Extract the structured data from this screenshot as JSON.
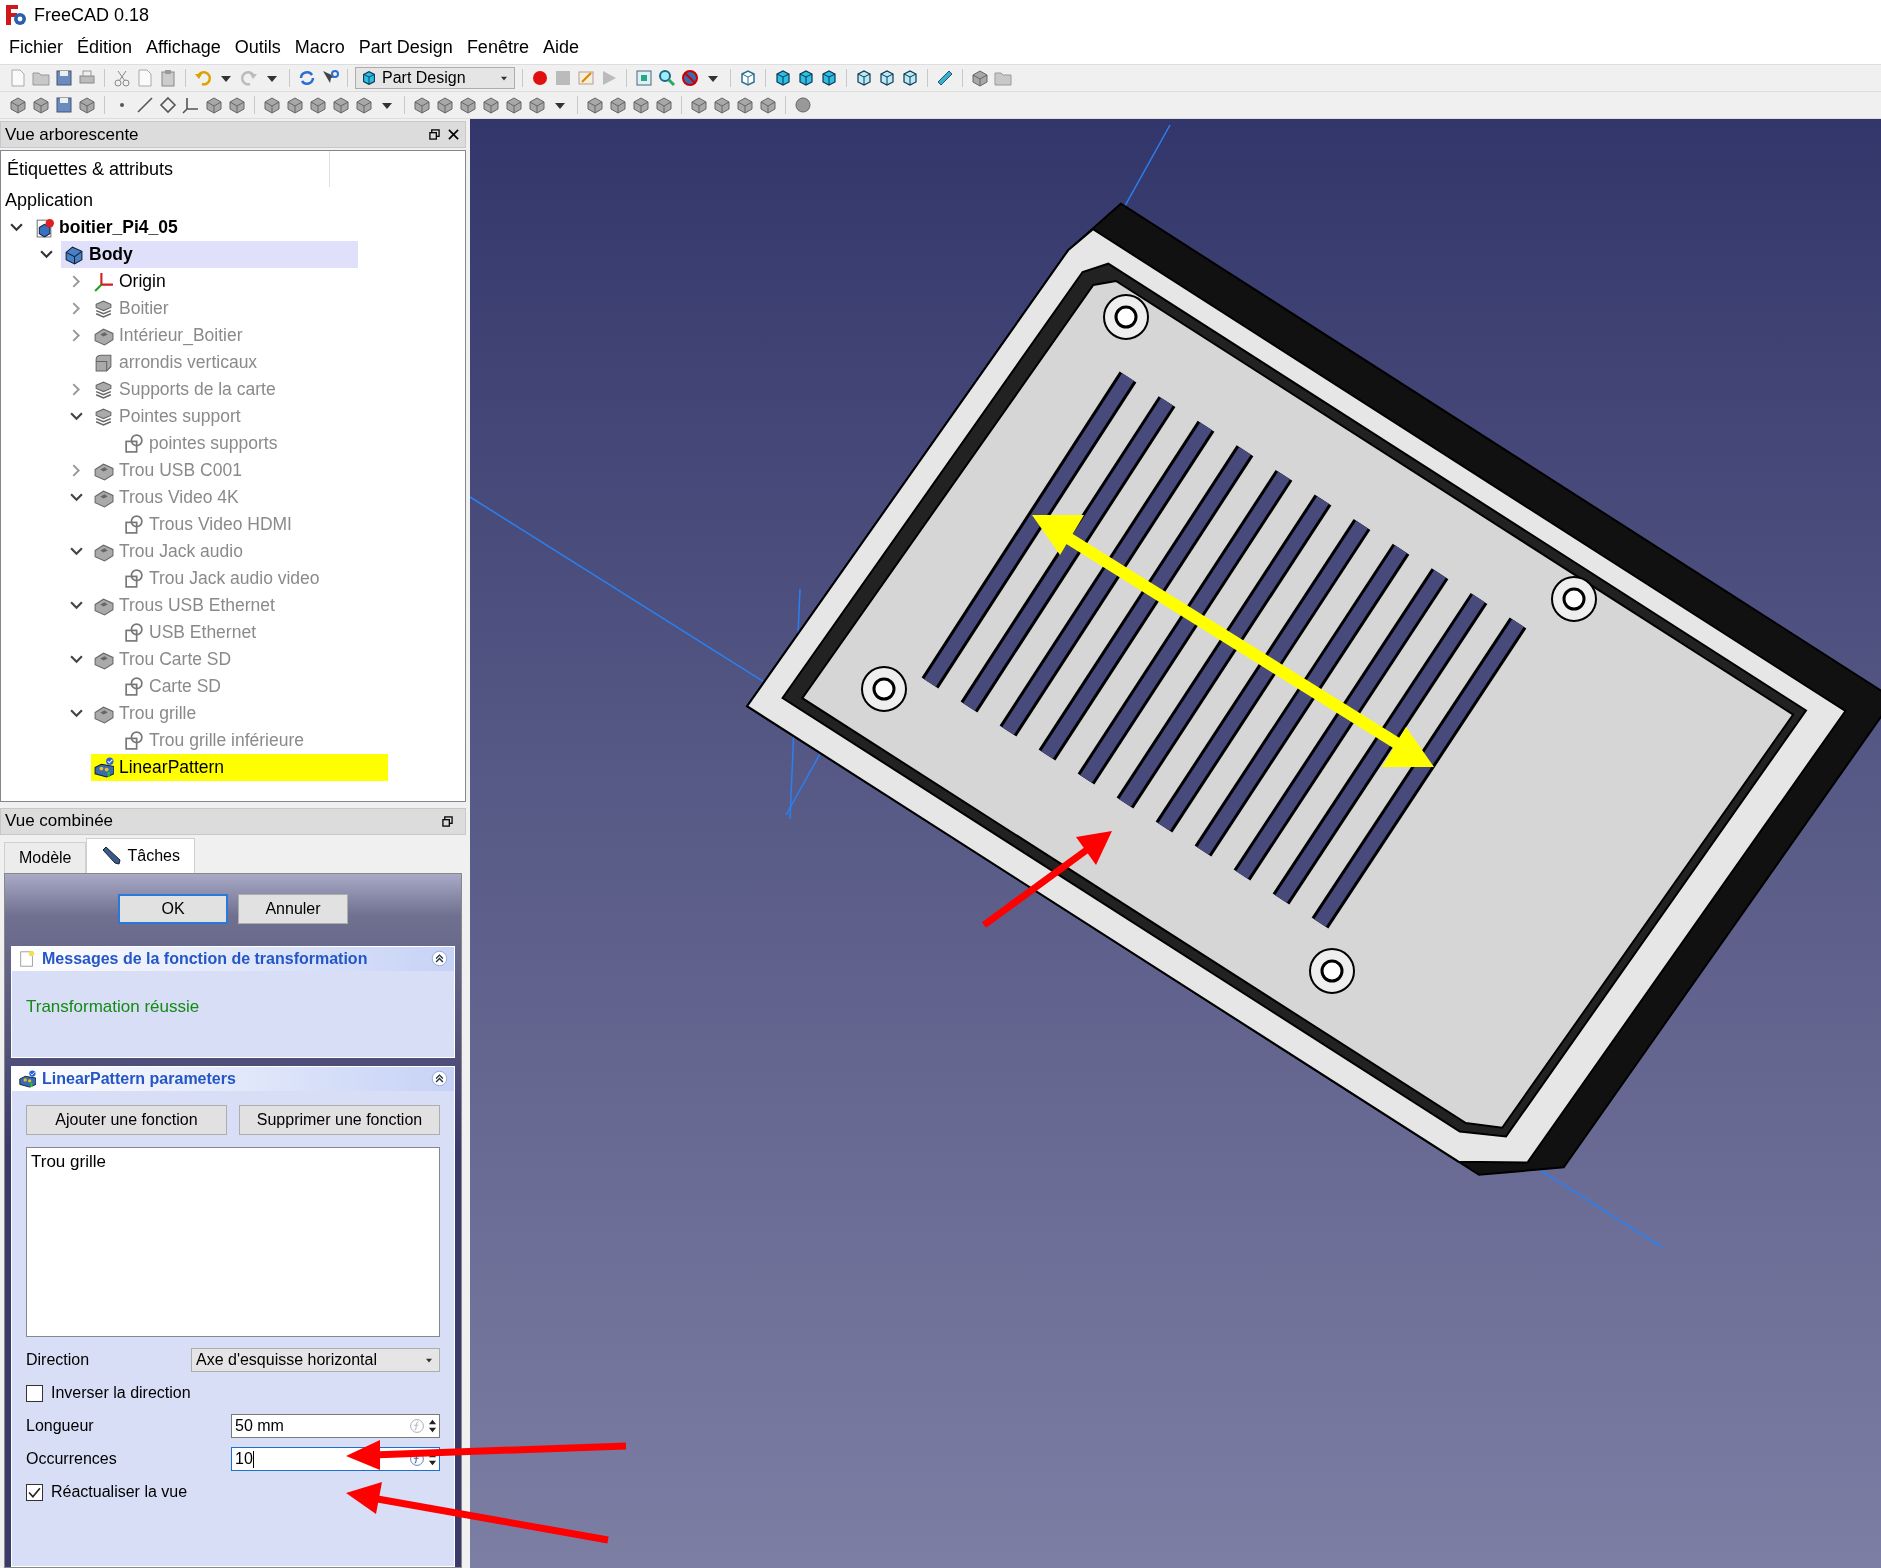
{
  "window": {
    "title": "FreeCAD 0.18"
  },
  "menu": [
    "Fichier",
    "Édition",
    "Affichage",
    "Outils",
    "Macro",
    "Part Design",
    "Fenêtre",
    "Aide"
  ],
  "toolbar": {
    "workbench": "Part Design"
  },
  "tree_panel": {
    "title": "Vue arborescente",
    "column": "Étiquettes & attributs",
    "root": "Application",
    "items": [
      {
        "label": "boitier_Pi4_05",
        "kind": "document",
        "visible": true,
        "active": false,
        "selected": false,
        "expanded": true,
        "children": [
          {
            "label": "Body",
            "kind": "body",
            "visible": true,
            "active": true,
            "selected": false,
            "expanded": true,
            "children": [
              {
                "label": "Origin",
                "kind": "origin",
                "visible": true,
                "active": false,
                "selected": false,
                "expanded": false
              },
              {
                "label": "Boitier",
                "kind": "stack",
                "visible": false,
                "active": false,
                "selected": false,
                "expanded": false
              },
              {
                "label": "Intérieur_Boitier",
                "kind": "pocket",
                "visible": false,
                "active": false,
                "selected": false,
                "expanded": false
              },
              {
                "label": "arrondis verticaux",
                "kind": "fillet",
                "visible": false,
                "active": false,
                "selected": false
              },
              {
                "label": "Supports de la carte",
                "kind": "stack",
                "visible": false,
                "active": false,
                "selected": false,
                "expanded": false
              },
              {
                "label": "Pointes support",
                "kind": "stack",
                "visible": false,
                "active": false,
                "selected": false,
                "expanded": true,
                "children": [
                  {
                    "label": "pointes supports",
                    "kind": "sketch",
                    "visible": false,
                    "active": false,
                    "selected": false
                  }
                ]
              },
              {
                "label": "Trou USB C001",
                "kind": "pocket",
                "visible": false,
                "active": false,
                "selected": false,
                "expanded": false
              },
              {
                "label": "Trous Video 4K",
                "kind": "pocket",
                "visible": false,
                "active": false,
                "selected": false,
                "expanded": true,
                "children": [
                  {
                    "label": "Trous Video HDMI",
                    "kind": "sketch",
                    "visible": false,
                    "active": false,
                    "selected": false
                  }
                ]
              },
              {
                "label": "Trou Jack audio",
                "kind": "pocket",
                "visible": false,
                "active": false,
                "selected": false,
                "expanded": true,
                "children": [
                  {
                    "label": "Trou Jack audio video",
                    "kind": "sketch",
                    "visible": false,
                    "active": false,
                    "selected": false
                  }
                ]
              },
              {
                "label": "Trous USB Ethernet",
                "kind": "pocket",
                "visible": false,
                "active": false,
                "selected": false,
                "expanded": true,
                "children": [
                  {
                    "label": "USB Ethernet",
                    "kind": "sketch",
                    "visible": false,
                    "active": false,
                    "selected": false
                  }
                ]
              },
              {
                "label": "Trou Carte SD",
                "kind": "pocket",
                "visible": false,
                "active": false,
                "selected": false,
                "expanded": true,
                "children": [
                  {
                    "label": "Carte SD",
                    "kind": "sketch",
                    "visible": false,
                    "active": false,
                    "selected": false
                  }
                ]
              },
              {
                "label": "Trou grille",
                "kind": "pocket",
                "visible": false,
                "active": false,
                "selected": false,
                "expanded": true,
                "children": [
                  {
                    "label": "Trou grille inférieure",
                    "kind": "sketch",
                    "visible": false,
                    "active": false,
                    "selected": false
                  }
                ]
              },
              {
                "label": "LinearPattern",
                "kind": "pattern",
                "visible": true,
                "active": false,
                "selected": true
              }
            ]
          }
        ]
      }
    ]
  },
  "combo_panel": {
    "title": "Vue combinée",
    "tabs": [
      {
        "label": "Modèle",
        "selected": false,
        "has_icon": false
      },
      {
        "label": "Tâches",
        "selected": true,
        "has_icon": true
      }
    ],
    "buttons": [
      {
        "label": "OK",
        "default": true
      },
      {
        "label": "Annuler",
        "default": false
      }
    ],
    "messages": {
      "title": "Messages de la fonction de transformation",
      "text": "Transformation réussie",
      "expanded": true
    },
    "parameters": {
      "title": "LinearPattern parameters",
      "expanded": true,
      "buttons": [
        "Ajouter une fonction",
        "Supprimer une fonction"
      ],
      "features": [
        "Trou grille"
      ],
      "direction": {
        "label": "Direction",
        "value": "Axe d'esquisse horizontal"
      },
      "reverse": {
        "label": "Inverser la direction",
        "checked": false
      },
      "length": {
        "label": "Longueur",
        "value": "50 mm",
        "focused": false
      },
      "occurrences": {
        "label": "Occurrences",
        "value": "10",
        "focused": true
      },
      "update_view": {
        "label": "Réactualiser la vue",
        "checked": true
      }
    }
  }
}
